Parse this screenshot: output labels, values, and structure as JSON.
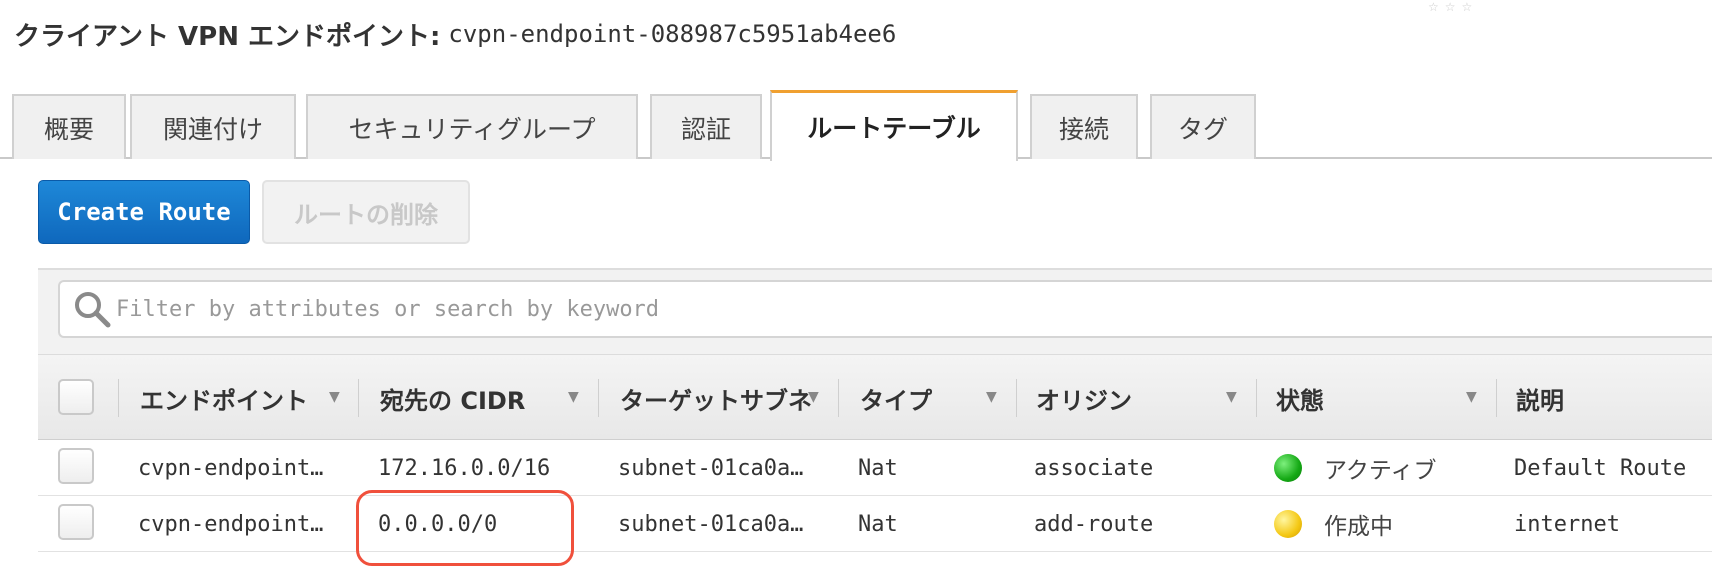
{
  "page": {
    "title_label": "クライアント VPN エンドポイント:",
    "title_value": "cvpn-endpoint-088987c5951ab4ee6"
  },
  "tabs": [
    {
      "label": "概要",
      "active": false
    },
    {
      "label": "関連付け",
      "active": false
    },
    {
      "label": "セキュリティグループ",
      "active": false
    },
    {
      "label": "認証",
      "active": false
    },
    {
      "label": "ルートテーブル",
      "active": true
    },
    {
      "label": "接続",
      "active": false
    },
    {
      "label": "タグ",
      "active": false
    }
  ],
  "toolbar": {
    "create_label": "Create Route",
    "delete_label": "ルートの削除"
  },
  "search": {
    "placeholder": "Filter by attributes or search by keyword"
  },
  "table": {
    "headers": [
      "エンドポイント",
      "宛先の CIDR",
      "ターゲットサブネ",
      "タイプ",
      "オリジン",
      "状態",
      "説明"
    ],
    "rows": [
      {
        "endpoint": "cvpn-endpoint…",
        "cidr": "172.16.0.0/16",
        "subnet": "subnet-01ca0a…",
        "type": "Nat",
        "origin": "associate",
        "status": "アクティブ",
        "status_color": "#15a915",
        "description": "Default Route"
      },
      {
        "endpoint": "cvpn-endpoint…",
        "cidr": "0.0.0.0/0",
        "subnet": "subnet-01ca0a…",
        "type": "Nat",
        "origin": "add-route",
        "status": "作成中",
        "status_color": "#f4c814",
        "description": "internet"
      }
    ]
  },
  "colors": {
    "accent_tab": "#f0a030",
    "primary_button": "#0f68bd",
    "highlight": "#f0503c"
  }
}
